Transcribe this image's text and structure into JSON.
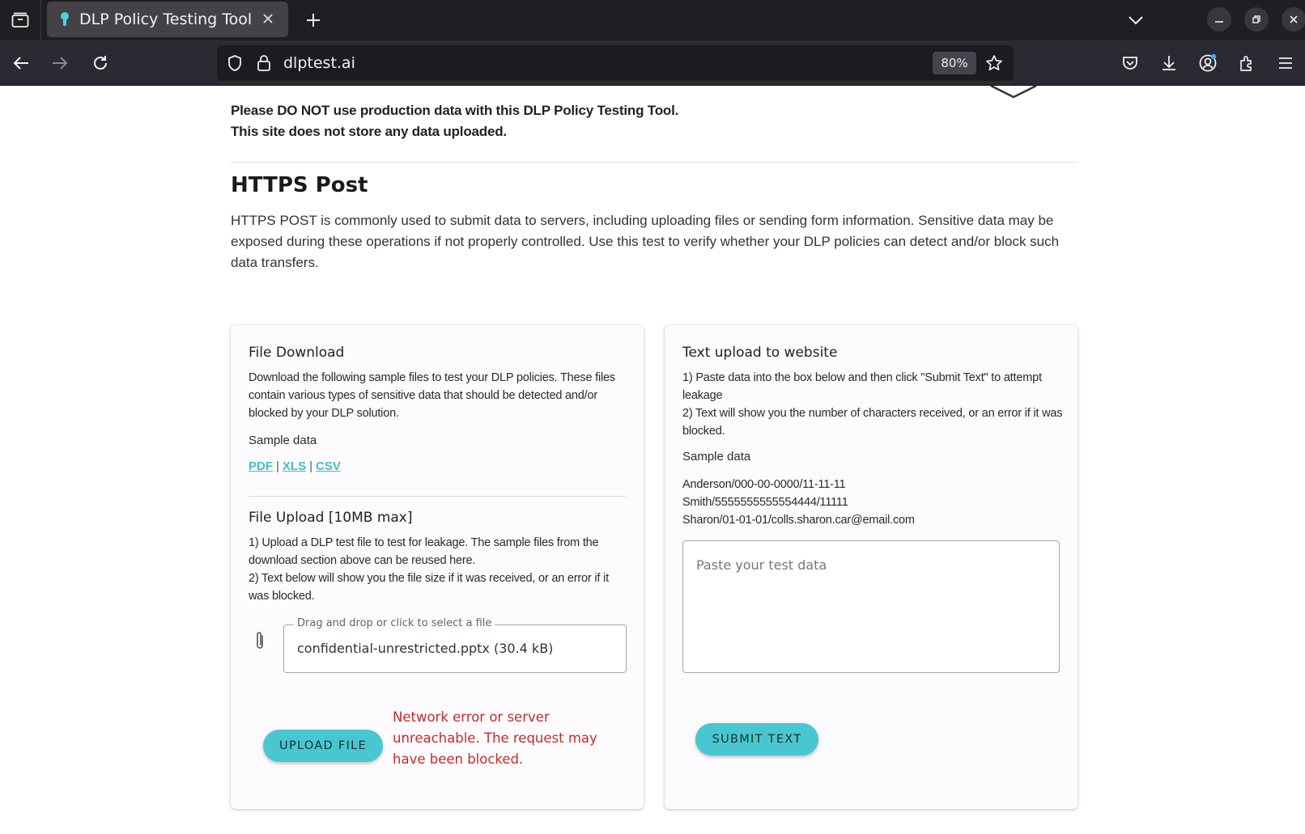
{
  "browser": {
    "tab_title": "DLP Policy Testing Tool",
    "url": "dlptest.ai",
    "zoom": "80%"
  },
  "page": {
    "warning_line1": "Please DO NOT use production data with this DLP Policy Testing Tool.",
    "warning_line2": "This site does not store any data uploaded.",
    "section_title": "HTTPS Post",
    "section_description": "HTTPS POST is commonly used to submit data to servers, including uploading files or sending form information. Sensitive data may be exposed during these operations if not properly controlled. Use this test to verify whether your DLP policies can detect and/or block such data transfers."
  },
  "file_download": {
    "title": "File Download",
    "description": "Download the following sample files to test your DLP policies. These files contain various types of sensitive data that should be detected and/or blocked by your DLP solution.",
    "sample_label": "Sample data",
    "links": [
      "PDF",
      "XLS",
      "CSV"
    ],
    "separator": "|"
  },
  "file_upload": {
    "title": "File Upload [10MB max]",
    "instruction1": "1) Upload a DLP test file to test for leakage. The sample files from the download section above can be reused here.",
    "instruction2": "2) Text below will show you the file size if it was received, or an error if it was blocked.",
    "field_label": "Drag and drop or click to select a file",
    "field_value": "confidential-unrestricted.pptx (30.4 kB)",
    "button_label": "UPLOAD FILE",
    "error_message": "Network error or server unreachable. The request may have been blocked."
  },
  "text_upload": {
    "title": "Text upload to website",
    "instruction1": "1) Paste data into the box below and then click \"Submit Text\" to attempt leakage",
    "instruction2": "2) Text will show you the number of characters received, or an error if it was blocked.",
    "sample_label": "Sample data",
    "samples": [
      "Anderson/000-00-0000/11-11-11",
      "Smith/5555555555554444/11111",
      "Sharon/01-01-01/colls.sharon.car@email.com"
    ],
    "textarea_placeholder": "Paste your test data",
    "button_label": "SUBMIT TEXT"
  },
  "colors": {
    "accent": "#48c7d0",
    "link": "#3fc0c9",
    "error": "#c62b2b"
  }
}
